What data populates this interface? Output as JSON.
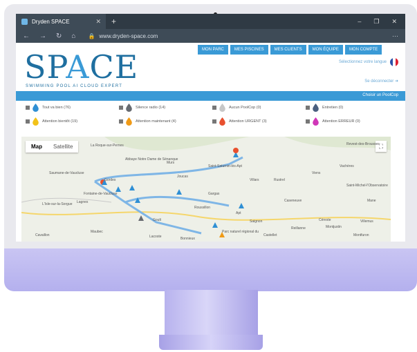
{
  "browser": {
    "tab_title": "Dryden SPACE",
    "url": "www.dryden-space.com",
    "new_tab": "+",
    "min": "–",
    "max": "❐",
    "close": "✕",
    "tab_close": "✕",
    "back": "←",
    "forward": "→",
    "refresh": "↻",
    "home": "⌂",
    "more": "···"
  },
  "brand": {
    "logo_text_left": "SP",
    "logo_text_a": "A",
    "logo_text_right": "CE",
    "tagline": "SWIMMING POOL AI CLOUD EXPERT"
  },
  "nav": {
    "items": [
      "MON PARC",
      "MES PISCINES",
      "MES CLIENTS",
      "MON ÉQUIPE",
      "MON COMPTE"
    ]
  },
  "language_label": "Sélectionnez votre langue",
  "logout_label": "Se déconnecter",
  "bluebar_label": "Choisir un PoolCop",
  "legend": [
    {
      "label": "Tout va bien (76)",
      "color": "#2f8fd4"
    },
    {
      "label": "Silence radio (14)",
      "color": "#666a70"
    },
    {
      "label": "Aucun PoolCop (0)",
      "color": "#c7c7c7"
    },
    {
      "label": "Entretien (0)",
      "color": "#4a5f7f"
    },
    {
      "label": "Attention bientôt (19)",
      "color": "#f2c21a"
    },
    {
      "label": "Attention maintenant (4)",
      "color": "#f09a16"
    },
    {
      "label": "Attention URGENT (3)",
      "color": "#e8502f"
    },
    {
      "label": "Attention ERREUR (0)",
      "color": "#d037b8"
    }
  ],
  "map": {
    "tab_map": "Map",
    "tab_satellite": "Satellite",
    "fullscreen_icon": "⛶",
    "place_labels": [
      "La Roque-sur-Pernes",
      "Abbaye Notre Dame de Sénanque",
      "Saumane-de-Vaucluse",
      "Fontaine-de-Vaucluse",
      "L'Isle-sur-la-Sorgue",
      "Lagnes",
      "Gordes",
      "Murs",
      "Joucas",
      "Saint-Saturnin-lès-Apt",
      "Gargas",
      "Villars",
      "Rustrel",
      "Roussillon",
      "Goult",
      "Saignon",
      "Apt",
      "Maubec",
      "Cavaillon",
      "Parc naturel régional du",
      "Castellet",
      "Caseneuve",
      "Viens",
      "Vachères",
      "Saint-Michel-l'Observatoire",
      "Mane",
      "Villemus",
      "Montjustin",
      "Céreste",
      "Reillanne",
      "Montfuron",
      "Revest-des-Brousses",
      "Bonnieux",
      "Lacoste"
    ]
  }
}
